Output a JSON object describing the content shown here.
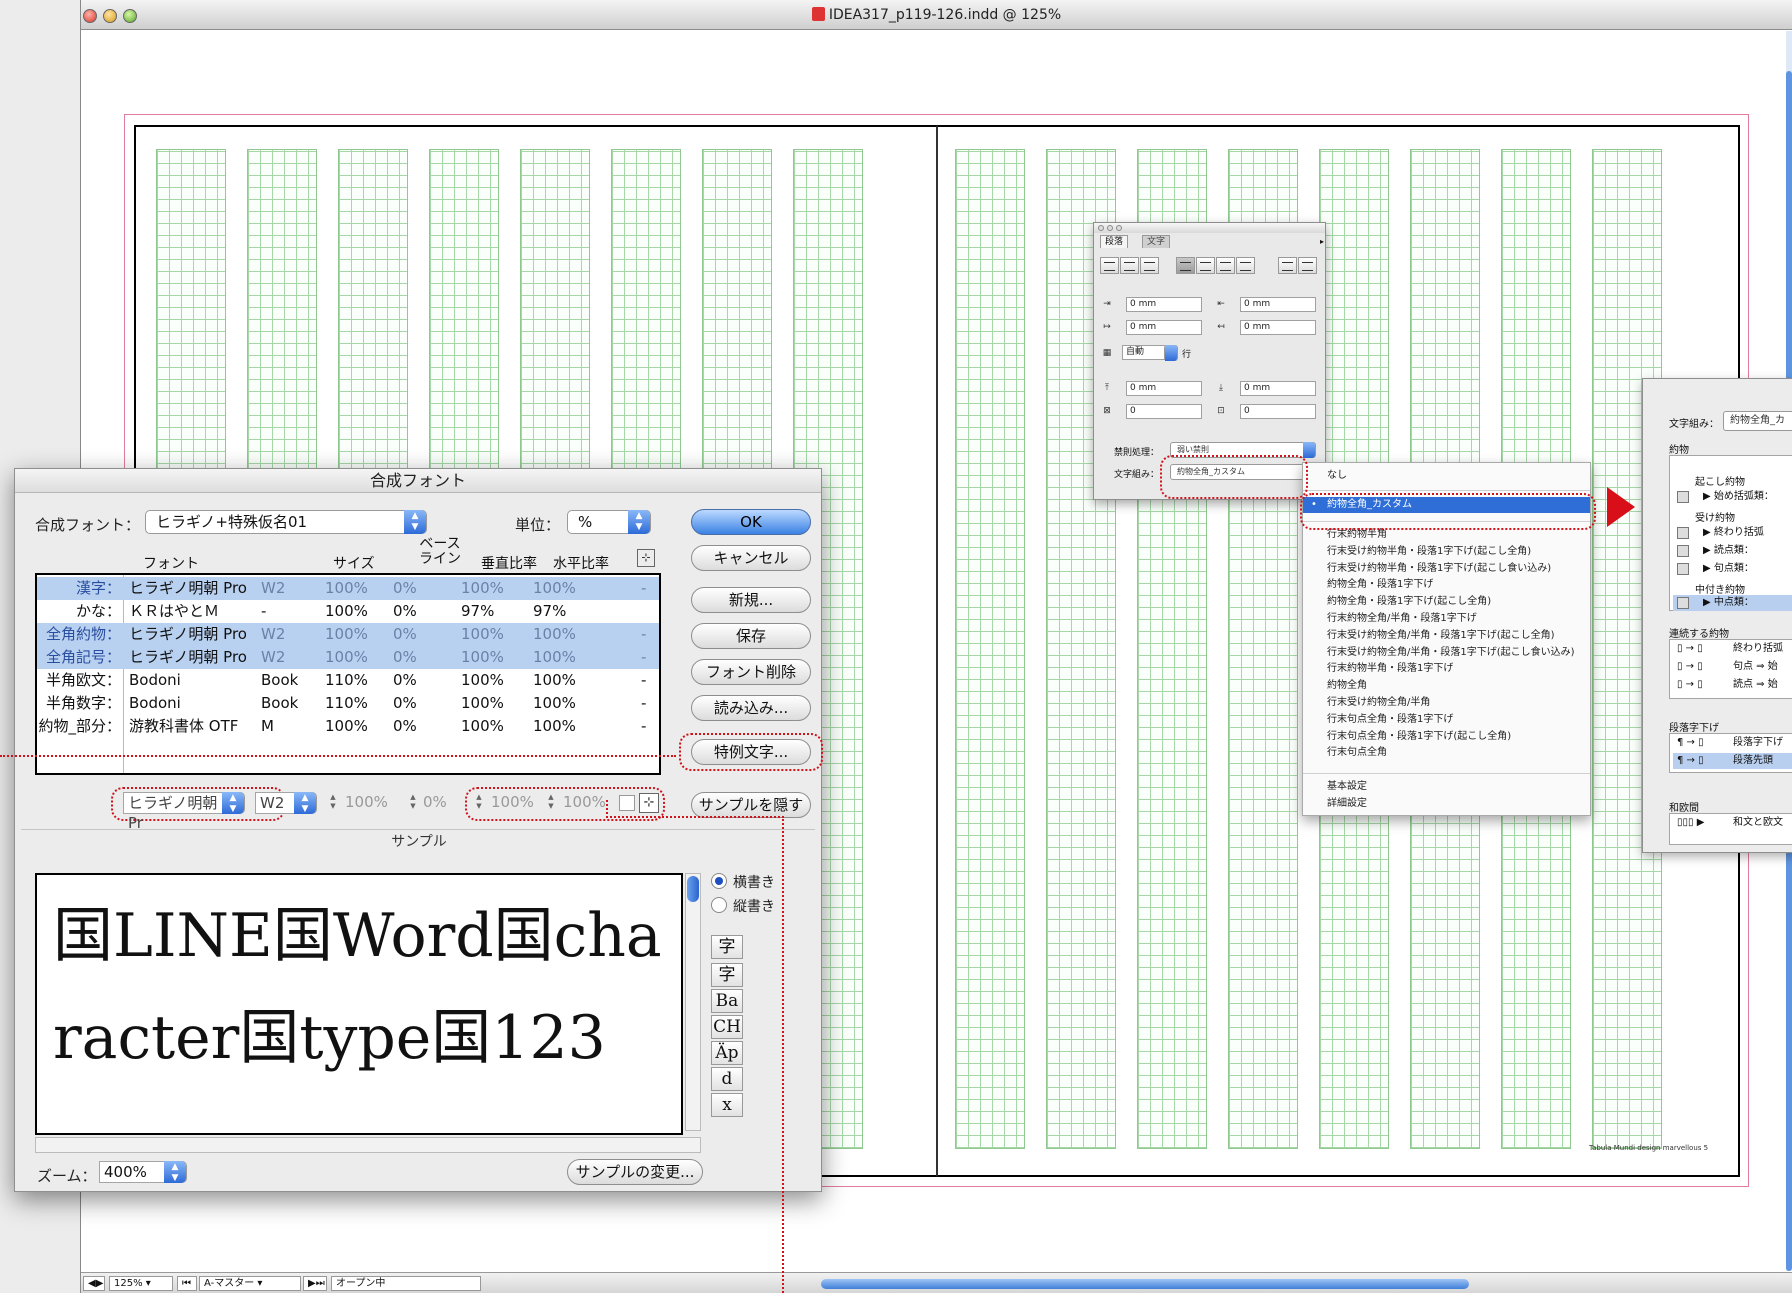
{
  "document": {
    "title": "IDEA317_p119-126.indd @ 125%",
    "footer": "Tabula Mundi design marvellous 5"
  },
  "statusbar": {
    "zoom": "125%",
    "page": "A-マスター",
    "preflight": "オープン中"
  },
  "composite_font_dialog": {
    "title": "合成フォント",
    "font_label": "合成フォント：",
    "font_value": "ヒラギノ+特殊仮名01",
    "unit_label": "単位：",
    "unit_value": "%",
    "columns": [
      "フォント",
      "サイズ",
      "ベース\nライン",
      "垂直比率",
      "水平比率"
    ],
    "rows": [
      {
        "label": "漢字：",
        "font": "ヒラギノ明朝 Pro",
        "weight": "W2",
        "size": "100%",
        "baseline": "0%",
        "vscale": "100%",
        "hscale": "100%",
        "extra": "-",
        "selected": true
      },
      {
        "label": "かな：",
        "font": "ＫＲはやとＭ",
        "weight": "-",
        "size": "100%",
        "baseline": "0%",
        "vscale": "97%",
        "hscale": "97%",
        "extra": "",
        "selected": false
      },
      {
        "label": "全角約物：",
        "font": "ヒラギノ明朝 Pro",
        "weight": "W2",
        "size": "100%",
        "baseline": "0%",
        "vscale": "100%",
        "hscale": "100%",
        "extra": "-",
        "selected": true
      },
      {
        "label": "全角記号：",
        "font": "ヒラギノ明朝 Pro",
        "weight": "W2",
        "size": "100%",
        "baseline": "0%",
        "vscale": "100%",
        "hscale": "100%",
        "extra": "-",
        "selected": true
      },
      {
        "label": "半角欧文：",
        "font": "Bodoni",
        "weight": "Book",
        "size": "110%",
        "baseline": "0%",
        "vscale": "100%",
        "hscale": "100%",
        "extra": "-",
        "selected": false
      },
      {
        "label": "半角数字：",
        "font": "Bodoni",
        "weight": "Book",
        "size": "110%",
        "baseline": "0%",
        "vscale": "100%",
        "hscale": "100%",
        "extra": "-",
        "selected": false
      },
      {
        "label": "約物_部分：",
        "font": "游教科書体 OTF",
        "weight": "M",
        "size": "100%",
        "baseline": "0%",
        "vscale": "100%",
        "hscale": "100%",
        "extra": "-",
        "selected": false
      }
    ],
    "edit_font": "ヒラギノ明朝 Pr",
    "edit_weight": "W2",
    "edit_size": "100%",
    "edit_baseline": "0%",
    "edit_vscale": "100%",
    "edit_hscale": "100%",
    "buttons": {
      "ok": "OK",
      "cancel": "キャンセル",
      "new": "新規...",
      "save": "保存",
      "delete": "フォント削除",
      "load": "読み込み...",
      "exceptions": "特例文字...",
      "hide_sample": "サンプルを隠す",
      "change_sample": "サンプルの変更..."
    },
    "sample_label": "サンプル",
    "sample_text": "国LINE国Word国character国type国123",
    "orientation": {
      "horizontal": "横書き",
      "vertical": "縦書き"
    },
    "tools": [
      "字",
      "字",
      "Ba",
      "CH",
      "Äp",
      "d",
      "x"
    ],
    "zoom_label": "ズーム：",
    "zoom_value": "400%"
  },
  "paragraph_panel": {
    "tabs": [
      "段落",
      "文字"
    ],
    "fields": {
      "left_indent": "0 mm",
      "right_indent": "0 mm",
      "first_line": "0 mm",
      "last_line": "0 mm",
      "lines": "自動",
      "lines_unit": "行",
      "space_before": "0 mm",
      "space_after": "0 mm",
      "drop_lines": "0",
      "drop_chars": "0"
    },
    "kinsoku_label": "禁則処理：",
    "kinsoku_value": "弱い禁則",
    "mojikumi_label": "文字組み：",
    "mojikumi_value": "約物全角_カスタム"
  },
  "mojikumi_menu": {
    "items_top": [
      "なし"
    ],
    "selected": "約物全角_カスタム",
    "items": [
      "行末約物半角",
      "行末受け約物半角・段落1字下げ(起こし全角)",
      "行末受け約物半角・段落1字下げ(起こし食い込み)",
      "約物全角・段落1字下げ",
      "約物全角・段落1字下げ(起こし全角)",
      "行末約物全角/半角・段落1字下げ",
      "行末受け約物全角/半角・段落1字下げ(起こし全角)",
      "行末受け約物全角/半角・段落1字下げ(起こし食い込み)",
      "行末約物半角・段落1字下げ",
      "約物全角",
      "行末受け約物全角/半角",
      "行末句点全角・段落1字下げ",
      "行末句点全角・段落1字下げ(起こし全角)",
      "行末句点全角"
    ],
    "items_bottom": [
      "基本設定",
      "詳細設定"
    ]
  },
  "mojikumi_settings_panel": {
    "mojikumi_label": "文字組み：",
    "mojikumi_value": "約物全角_カ",
    "section_yakumono": "約物",
    "okoshi": "起こし約物",
    "start_bracket": "始め括弧類：",
    "uke": "受け約物",
    "end_bracket": "終わり括弧",
    "comma": "読点類：",
    "period": "句点類：",
    "nakatsuki": "中付き約物",
    "middle_dot": "中点類：",
    "section_renzoku": "連続する約物",
    "r1": "終わり括弧",
    "r2": "句点 ⇒ 始",
    "r3": "読点 ⇒ 始",
    "section_indent": "段落字下げ",
    "i1": "段落字下げ",
    "i2": "段落先頭",
    "section_wao": "和欧間",
    "w1": "和文と欧文"
  }
}
